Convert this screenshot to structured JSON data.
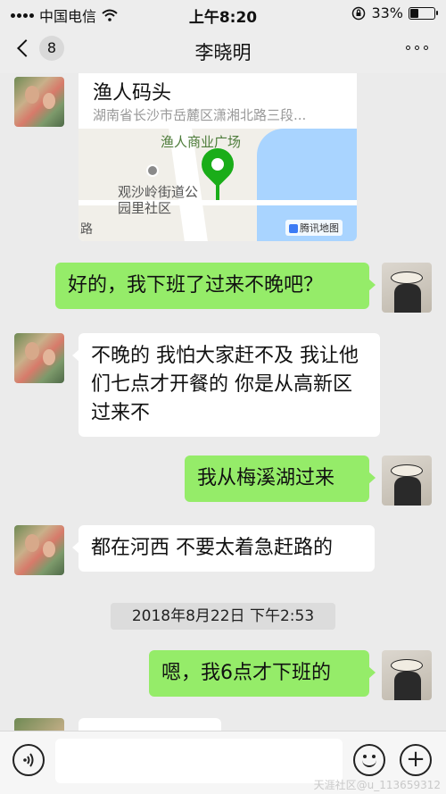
{
  "status_bar": {
    "carrier": "中国电信",
    "time": "上午8:20",
    "battery": "33%",
    "battery_level": 0.33,
    "icons": [
      "signal-icon",
      "wifi-icon",
      "rotation-lock-icon",
      "battery-icon"
    ]
  },
  "nav": {
    "unread_count": "8",
    "title": "李晓明",
    "icons": [
      "back-arrow-icon",
      "more-icon"
    ]
  },
  "location": {
    "name": "渔人码头",
    "address": "湖南省长沙市岳麓区潇湘北路三段...",
    "map_poi": "渔人商业广场",
    "map_label": "观沙岭街道公园里社区",
    "map_edge_text": "路",
    "map_credit": "腾讯地图"
  },
  "messages": [
    {
      "side": "right",
      "text": "好的，我下班了过来不晚吧？"
    },
    {
      "side": "left",
      "text": "不晚的 我怕大家赶不及 我让他们七点才开餐的 你是从高新区过来不"
    },
    {
      "side": "right",
      "text": "我从梅溪湖过来"
    },
    {
      "side": "left",
      "text": "都在河西 不要太着急赶路的"
    },
    {
      "side": "right",
      "text": "嗯，我6点才下班的"
    }
  ],
  "timestamp": "2018年8月22日 下午2:53",
  "input_bar": {
    "placeholder": "",
    "icons": [
      "voice-icon",
      "emoji-icon",
      "plus-icon"
    ]
  },
  "watermark": "天涯社区@u_113659312"
}
